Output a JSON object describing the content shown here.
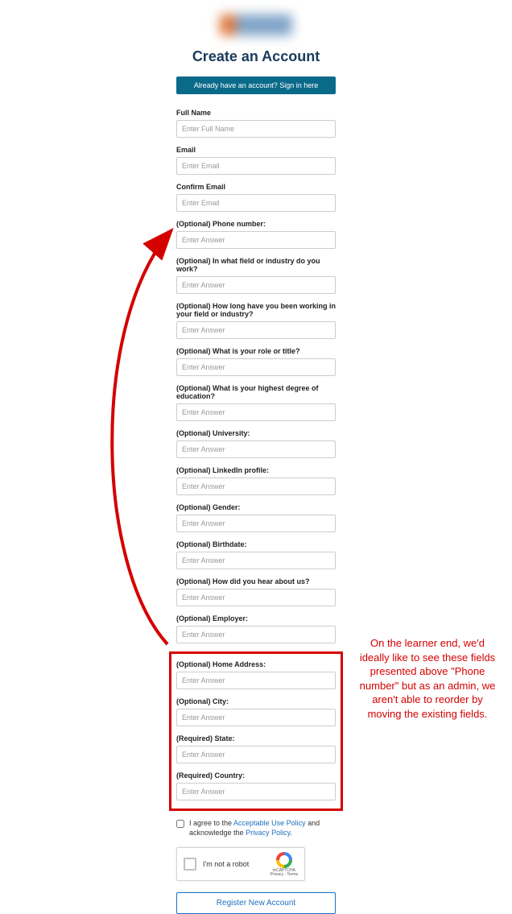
{
  "title": "Create an Account",
  "signin_label": "Already have an account? Sign in here",
  "placeholders": {
    "full_name": "Enter Full Name",
    "email": "Enter Email",
    "answer": "Enter Answer"
  },
  "labels": {
    "full_name": "Full Name",
    "email": "Email",
    "confirm_email": "Confirm Email",
    "phone": "(Optional) Phone number:",
    "field_industry": "(Optional) In what field or industry do you work?",
    "tenure": "(Optional) How long have you been working in your field or industry?",
    "role": "(Optional) What is your role or title?",
    "education": "(Optional) What is your highest degree of education?",
    "university": "(Optional) University:",
    "linkedin": "(Optional) LinkedIn profile:",
    "gender": "(Optional) Gender:",
    "birthdate": "(Optional) Birthdate:",
    "hear": "(Optional) How did you hear about us?",
    "employer": "(Optional) Employer:",
    "home_address": "(Optional) Home Address:",
    "city": "(Optional) City:",
    "state": "(Required) State:",
    "country": "(Required) Country:"
  },
  "consent": {
    "prefix": "I agree to the ",
    "aup": "Acceptable Use Policy",
    "middle": " and acknowledge the ",
    "privacy": "Privacy Policy",
    "suffix": "."
  },
  "captcha": {
    "label": "I'm not a robot",
    "brand": "reCAPTCHA",
    "terms": "Privacy - Terms"
  },
  "register_label": "Register New Account",
  "annotation": "On the learner end, we'd ideally like to see these fields presented above \"Phone number\" but as an admin, we aren't able to reorder by moving the existing fields."
}
